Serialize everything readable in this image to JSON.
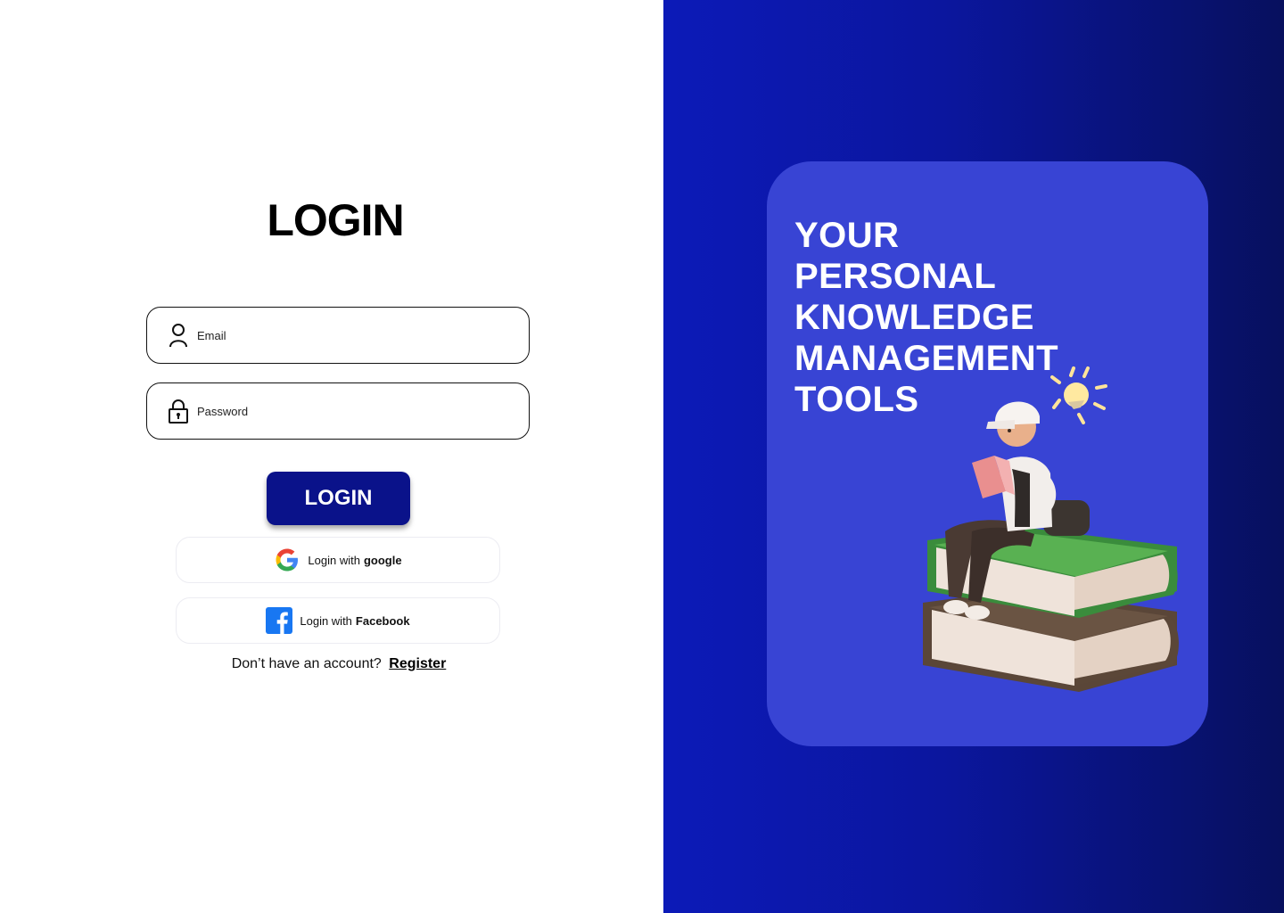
{
  "login": {
    "title": "LOGIN",
    "email_placeholder": "Email",
    "password_placeholder": "Password",
    "button_label": "LOGIN",
    "google": {
      "prefix": "Login with",
      "brand": "google",
      "icon": "google-icon"
    },
    "facebook": {
      "prefix": "Login with",
      "brand": "Facebook",
      "icon": "facebook-icon"
    },
    "register_prompt": "Don’t have an account?",
    "register_link": "Register"
  },
  "promo": {
    "headline_lines": [
      "YOUR",
      "PERSONAL",
      "KNOWLEDGE",
      "MANAGEMENT",
      "TOOLS"
    ]
  },
  "colors": {
    "primary_button": "#0a128a",
    "card": "#3844d4",
    "gradient_start": "#0c1ab8",
    "gradient_end": "#07105e"
  }
}
